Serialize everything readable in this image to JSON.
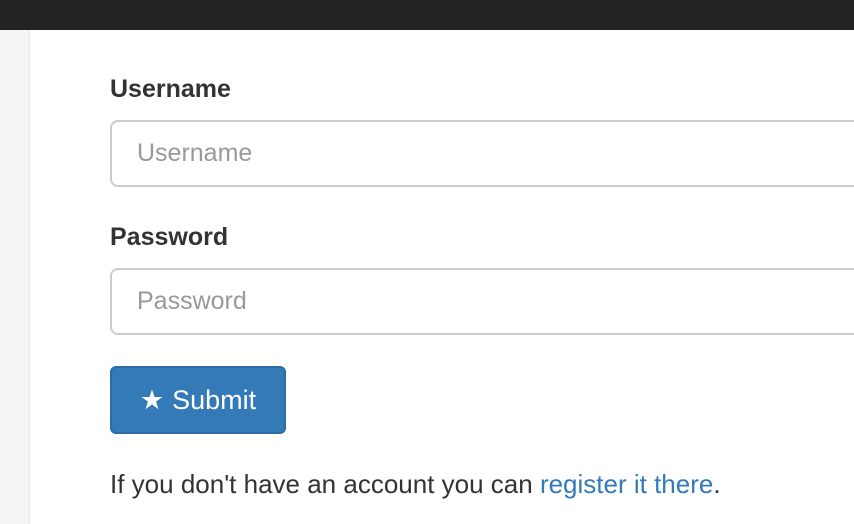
{
  "form": {
    "username_label": "Username",
    "username_placeholder": "Username",
    "username_value": "",
    "password_label": "Password",
    "password_placeholder": "Password",
    "password_value": "",
    "submit_label": "Submit",
    "submit_icon": "star-icon"
  },
  "footer": {
    "text": "If you don't have an account you can ",
    "link": "register it there",
    "end": "."
  },
  "colors": {
    "accent": "#337ab7",
    "topbar": "#222222"
  }
}
